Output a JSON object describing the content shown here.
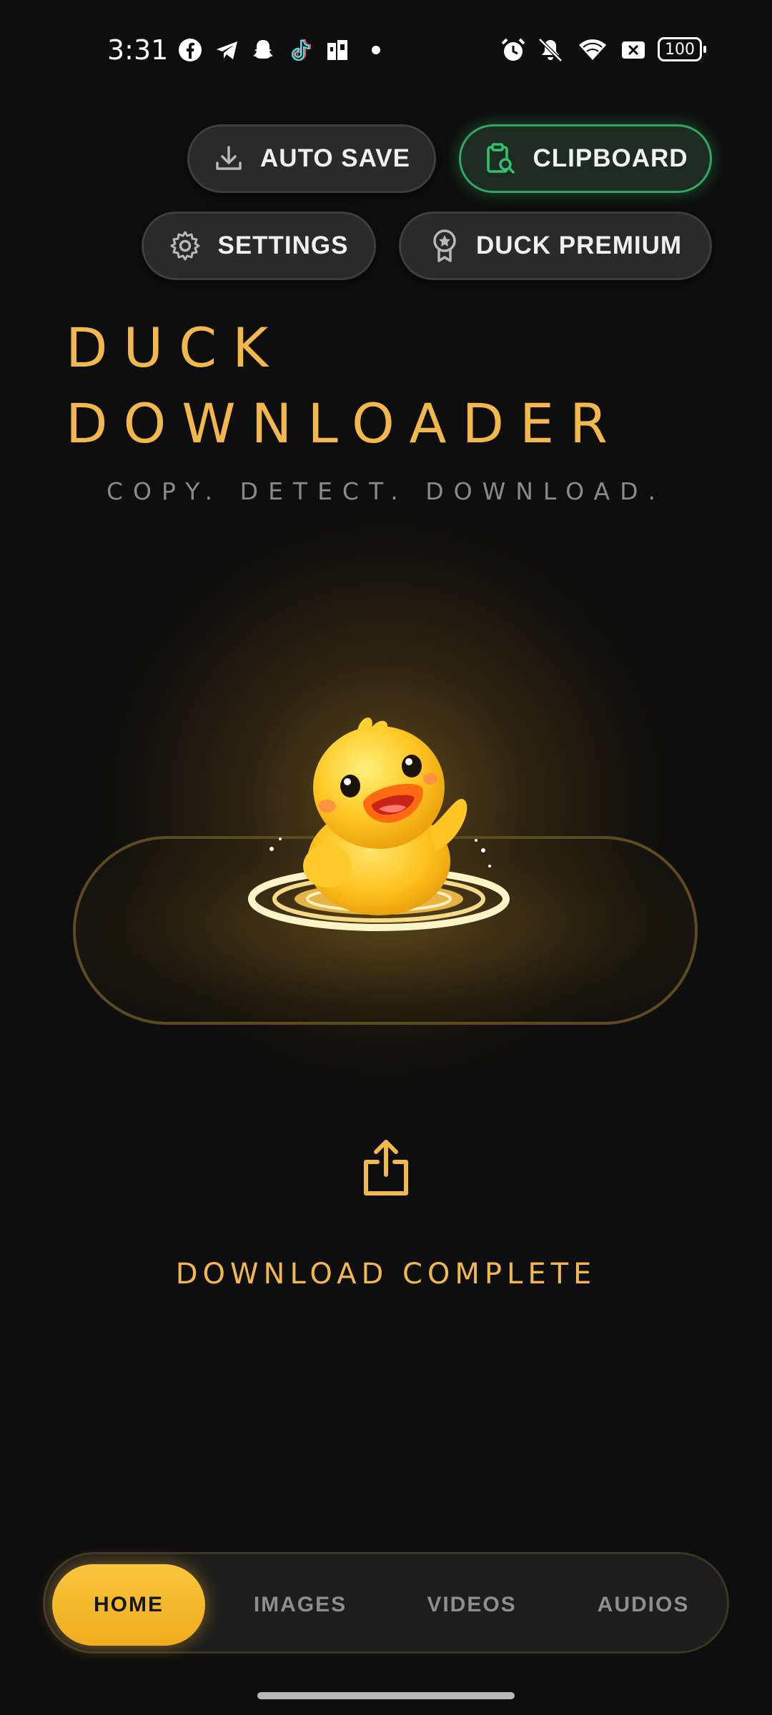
{
  "status_bar": {
    "time": "3:31",
    "battery": "100",
    "icons": [
      "facebook-icon",
      "telegram-icon",
      "snapchat-icon",
      "tiktok-icon",
      "app-icon",
      "dot-icon",
      "alarm-icon",
      "mute-icon",
      "wifi-icon",
      "sim-off-icon",
      "battery-icon"
    ]
  },
  "top_actions": {
    "auto_save": "AUTO SAVE",
    "clipboard": "CLIPBOARD",
    "settings": "SETTINGS",
    "premium": "DUCK PREMIUM"
  },
  "header": {
    "title_line1": "DUCK",
    "title_line2": "DOWNLOADER",
    "tagline": "COPY. DETECT. DOWNLOAD."
  },
  "main": {
    "status": "DOWNLOAD COMPLETE"
  },
  "bottom_nav": {
    "items": [
      {
        "label": "HOME",
        "active": true
      },
      {
        "label": "IMAGES",
        "active": false
      },
      {
        "label": "VIDEOS",
        "active": false
      },
      {
        "label": "AUDIOS",
        "active": false
      }
    ]
  },
  "colors": {
    "accent": "#f2b84b",
    "active_green": "#2fa864",
    "background": "#0e0e0e"
  }
}
